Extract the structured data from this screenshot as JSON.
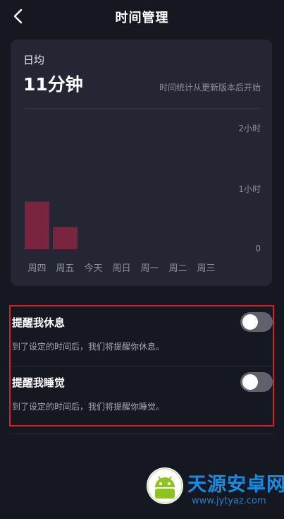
{
  "header": {
    "title": "时间管理",
    "back_icon": "chevron-left-icon"
  },
  "stats": {
    "daily_label": "日均",
    "daily_value": "11分钟",
    "note": "时间统计从更新版本后开始"
  },
  "chart_data": {
    "type": "bar",
    "categories": [
      "周四",
      "周五",
      "今天",
      "周日",
      "周一",
      "周二",
      "周三"
    ],
    "values": [
      47,
      22,
      0,
      0,
      0,
      0,
      0
    ],
    "unit": "minutes",
    "ylim": [
      0,
      120
    ],
    "yticks": [
      {
        "label": "2小时",
        "value": 120
      },
      {
        "label": "1小时",
        "value": 60
      },
      {
        "label": "0",
        "value": 0
      }
    ],
    "bar_color": "#7a2540",
    "grid": false
  },
  "reminders": [
    {
      "title": "提醒我休息",
      "description": "到了设定的时间后，我们将提醒你休息。",
      "enabled": false
    },
    {
      "title": "提醒我睡觉",
      "description": "到了设定的时间后，我们将提醒你睡觉。",
      "enabled": false
    }
  ],
  "colors": {
    "background": "#161821",
    "card": "#242733",
    "highlight_border": "#d81e2a",
    "toggle_off": "#5f626d"
  },
  "watermark": {
    "text": "天源安卓网",
    "url": "www.jytyaz.com"
  }
}
